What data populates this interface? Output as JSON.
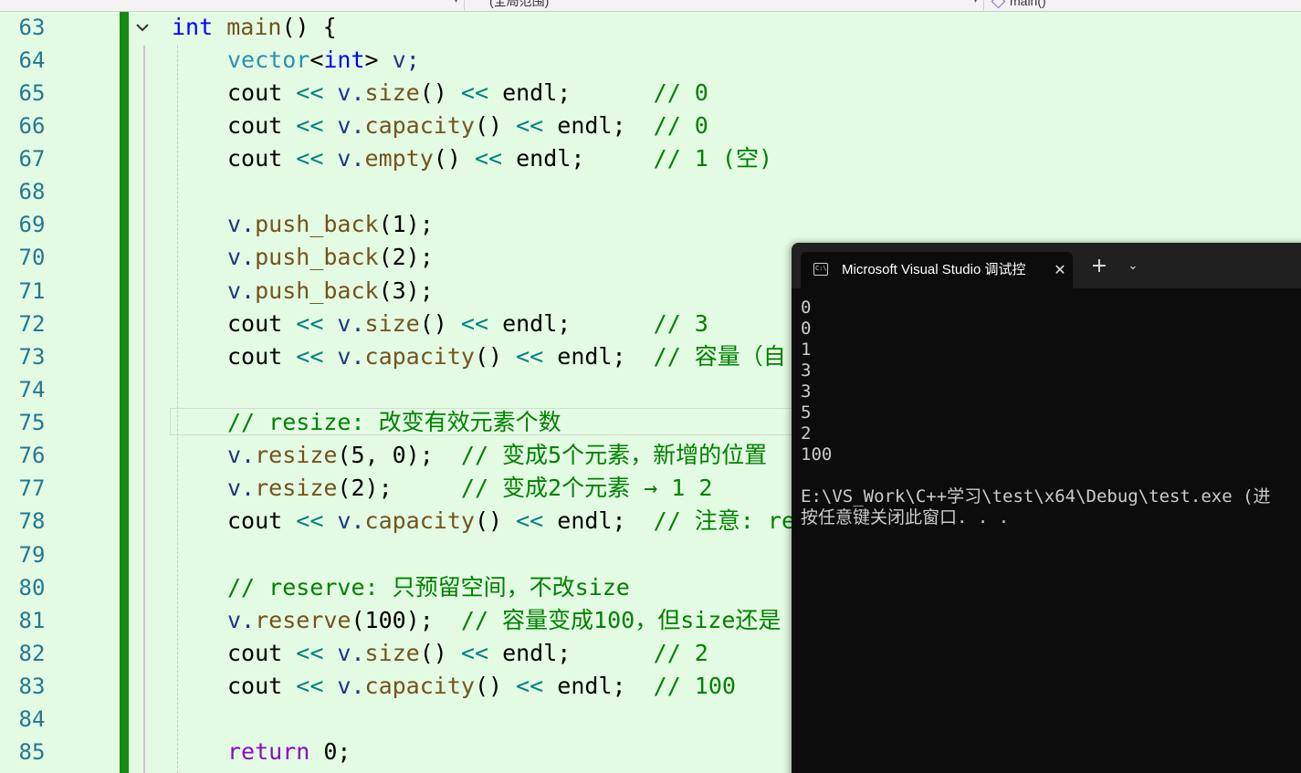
{
  "nav": {
    "project_dropdown": "",
    "scope_dropdown": "(全局范围)",
    "member_dropdown": "main()"
  },
  "editor": {
    "line_numbers": [
      "63",
      "64",
      "65",
      "66",
      "67",
      "68",
      "69",
      "70",
      "71",
      "72",
      "73",
      "74",
      "75",
      "76",
      "77",
      "78",
      "79",
      "80",
      "81",
      "82",
      "83",
      "84",
      "85"
    ],
    "current_line": "75",
    "code": {
      "l63": {
        "kw": "int",
        "fn": "main",
        "rest": "() {"
      },
      "l64": {
        "ty": "vector",
        "lt": "<",
        "kw": "int",
        "gt": ">",
        "var": " v;"
      },
      "l65": {
        "a": "cout ",
        "op1": "<<",
        "b": " v.",
        "m": "size",
        "c": "() ",
        "op2": "<<",
        "d": " endl;      ",
        "cm": "// 0"
      },
      "l66": {
        "a": "cout ",
        "op1": "<<",
        "b": " v.",
        "m": "capacity",
        "c": "() ",
        "op2": "<<",
        "d": " endl;  ",
        "cm": "// 0"
      },
      "l67": {
        "a": "cout ",
        "op1": "<<",
        "b": " v.",
        "m": "empty",
        "c": "() ",
        "op2": "<<",
        "d": " endl;     ",
        "cm": "// 1 (空)"
      },
      "l69": {
        "b": "v.",
        "m": "push_back",
        "c": "(1);"
      },
      "l70": {
        "b": "v.",
        "m": "push_back",
        "c": "(2);"
      },
      "l71": {
        "b": "v.",
        "m": "push_back",
        "c": "(3);"
      },
      "l72": {
        "a": "cout ",
        "op1": "<<",
        "b": " v.",
        "m": "size",
        "c": "() ",
        "op2": "<<",
        "d": " endl;      ",
        "cm": "// 3"
      },
      "l73": {
        "a": "cout ",
        "op1": "<<",
        "b": " v.",
        "m": "capacity",
        "c": "() ",
        "op2": "<<",
        "d": " endl;  ",
        "cm": "// 容量（自"
      },
      "l75": {
        "cm": "// resize: 改变有效元素个数"
      },
      "l76": {
        "b": "v.",
        "m": "resize",
        "c": "(5, 0);  ",
        "cm": "// 变成5个元素，新增的位置"
      },
      "l77": {
        "b": "v.",
        "m": "resize",
        "c": "(2);     ",
        "cm": "// 变成2个元素 → 1 2"
      },
      "l78": {
        "a": "cout ",
        "op1": "<<",
        "b": " v.",
        "m": "capacity",
        "c": "() ",
        "op2": "<<",
        "d": " endl;  ",
        "cm": "// 注意: re"
      },
      "l80": {
        "cm": "// reserve: 只预留空间，不改size"
      },
      "l81": {
        "b": "v.",
        "m": "reserve",
        "c": "(100);  ",
        "cm": "// 容量变成100，但size还是"
      },
      "l82": {
        "a": "cout ",
        "op1": "<<",
        "b": " v.",
        "m": "size",
        "c": "() ",
        "op2": "<<",
        "d": " endl;      ",
        "cm": "// 2"
      },
      "l83": {
        "a": "cout ",
        "op1": "<<",
        "b": " v.",
        "m": "capacity",
        "c": "() ",
        "op2": "<<",
        "d": " endl;  ",
        "cm": "// 100"
      },
      "l85": {
        "kw": "return",
        "rest": " 0;"
      }
    }
  },
  "console": {
    "tab_title": "Microsoft Visual Studio 调试控",
    "close_glyph": "✕",
    "new_tab_glyph": "+",
    "dropdown_glyph": "⌄",
    "output": [
      "0",
      "0",
      "1",
      "3",
      "3",
      "5",
      "2",
      "100",
      "",
      "E:\\VS_Work\\C++学习\\test\\x64\\Debug\\test.exe (进",
      "按任意键关闭此窗口. . ."
    ]
  }
}
